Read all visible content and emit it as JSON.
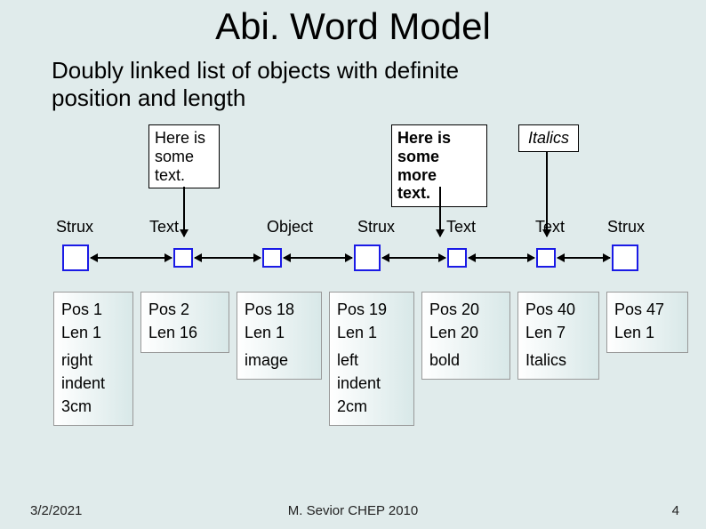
{
  "title": "Abi. Word Model",
  "subtitle_l1": "Doubly linked list of objects with definite",
  "subtitle_l2": "position and length",
  "bubbles": {
    "b1_l1": "Here is",
    "b1_l2": "some",
    "b1_l3": "text.",
    "b2_l1": "Here is",
    "b2_l2": "some more",
    "b2_l3": "text.",
    "b3": "Italics"
  },
  "labels": {
    "n0": "Strux",
    "n1": "Text",
    "n2": "Object",
    "n3": "Strux",
    "n4": "Text",
    "n5": "Text",
    "n6": "Strux"
  },
  "info": {
    "c0": {
      "pos": "Pos 1",
      "len": "Len 1",
      "extra1": "right",
      "extra2": "indent",
      "extra3": "3cm"
    },
    "c1": {
      "pos": "Pos 2",
      "len": "Len 16"
    },
    "c2": {
      "pos": "Pos 18",
      "len": "Len 1",
      "extra1": "image"
    },
    "c3": {
      "pos": "Pos 19",
      "len": "Len 1",
      "extra1": "left",
      "extra2": "indent",
      "extra3": "2cm"
    },
    "c4": {
      "pos": "Pos 20",
      "len": "Len 20",
      "extra1": "bold"
    },
    "c5": {
      "pos": "Pos 40",
      "len": "Len 7",
      "extra1": "Italics"
    },
    "c6": {
      "pos": "Pos 47",
      "len": "Len 1"
    }
  },
  "footer": {
    "date": "3/2/2021",
    "center": "M. Sevior CHEP 2010",
    "page": "4"
  }
}
